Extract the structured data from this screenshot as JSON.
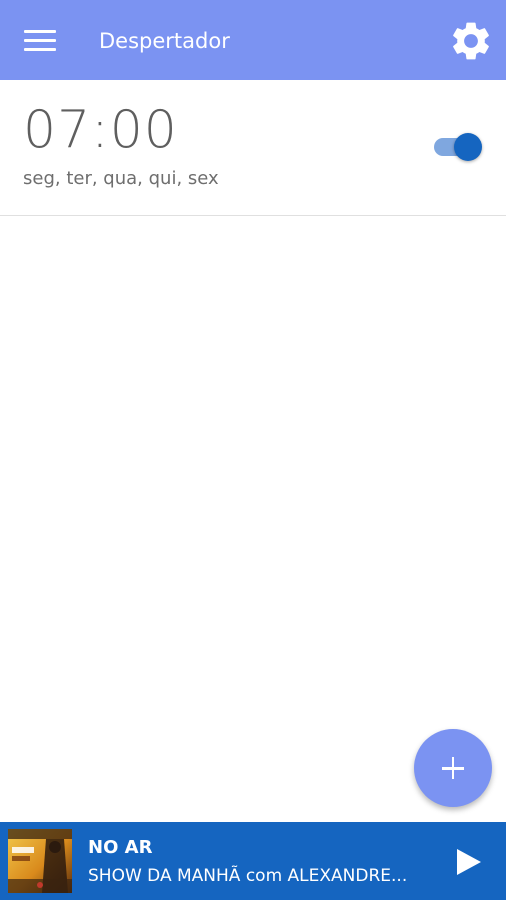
{
  "appbar": {
    "title": "Despertador",
    "menu_icon": "menu-icon",
    "settings_icon": "gear-icon",
    "color": "#7b93f2"
  },
  "alarms": [
    {
      "time": "07:00",
      "days": "seg, ter, qua, qui, sex",
      "enabled": true
    }
  ],
  "fab": {
    "icon": "plus-icon"
  },
  "player": {
    "status": "NO AR",
    "show": "SHOW DA MANHÃ com ALEXANDRE...",
    "play_icon": "play-icon",
    "color": "#1565c0"
  }
}
